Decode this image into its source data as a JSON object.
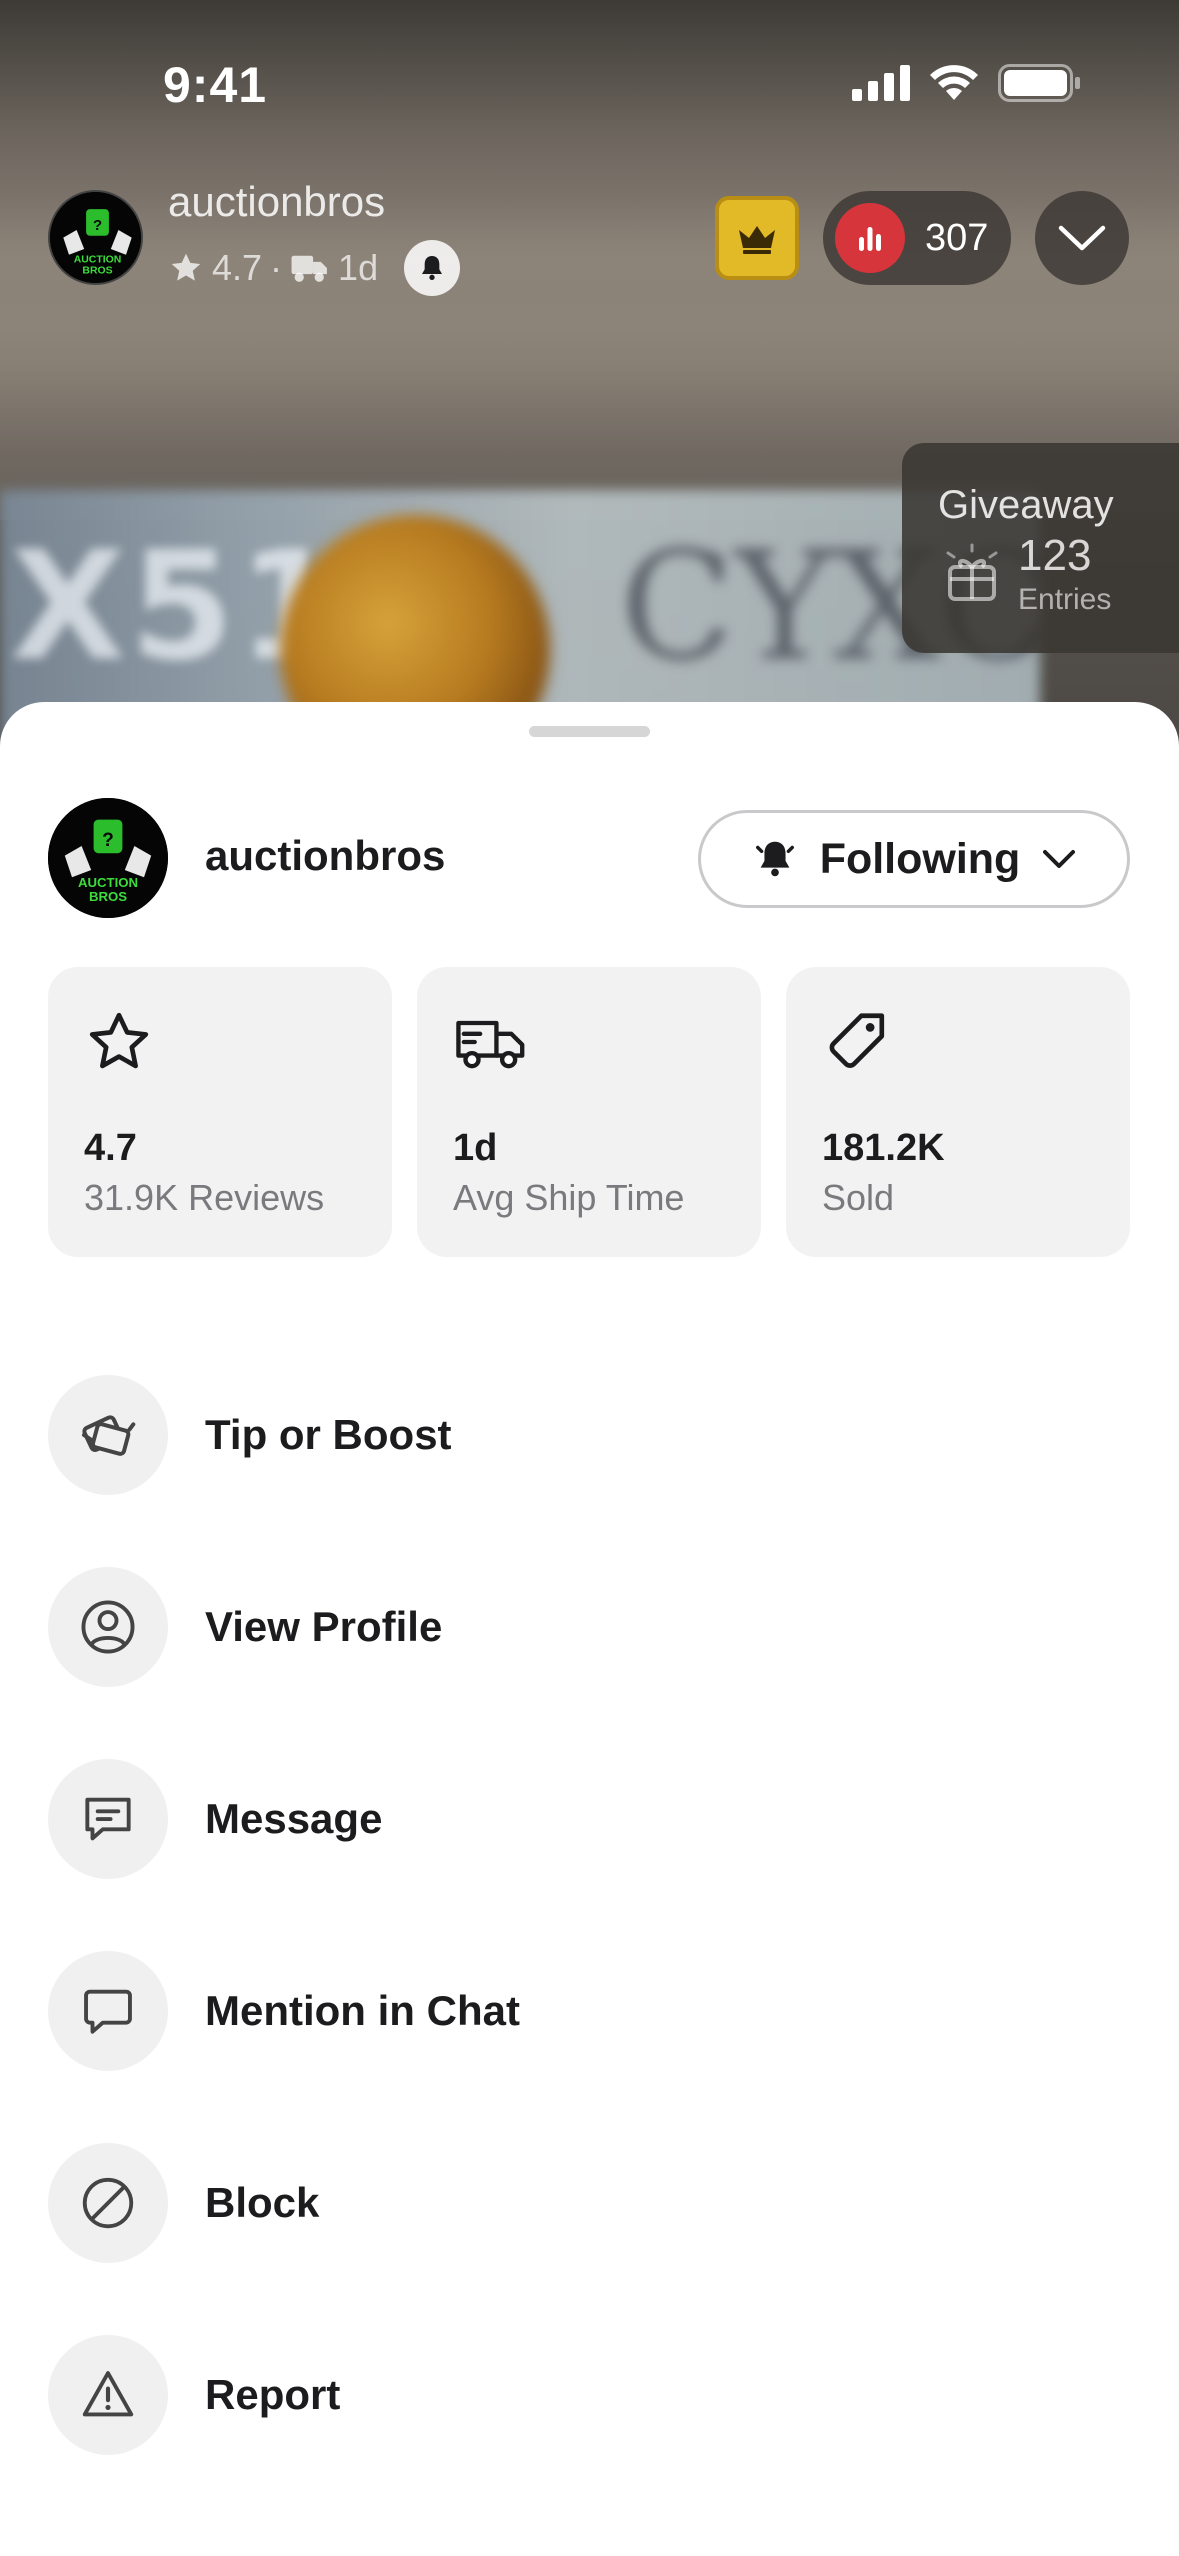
{
  "status_bar": {
    "time": "9:41"
  },
  "stream_header": {
    "seller_name": "auctionbros",
    "rating": "4.7",
    "separator": "·",
    "ship_time": "1d",
    "viewer_count": "307"
  },
  "giveaway": {
    "title": "Giveaway",
    "entries_count": "123",
    "entries_label": "Entries"
  },
  "avatar_logo": {
    "line1": "AUCTION",
    "line2": "BROS"
  },
  "sheet": {
    "seller_name": "auctionbros",
    "follow_label": "Following",
    "stats": [
      {
        "icon": "star-icon",
        "value": "4.7",
        "label": "31.9K Reviews"
      },
      {
        "icon": "truck-icon",
        "value": "1d",
        "label": "Avg Ship Time"
      },
      {
        "icon": "tag-icon",
        "value": "181.2K",
        "label": "Sold"
      }
    ],
    "menu": [
      {
        "icon": "boost-icon",
        "label": "Tip or Boost"
      },
      {
        "icon": "profile-icon",
        "label": "View Profile"
      },
      {
        "icon": "message-icon",
        "label": "Message"
      },
      {
        "icon": "chat-bubble-icon",
        "label": "Mention in Chat"
      },
      {
        "icon": "block-icon",
        "label": "Block"
      },
      {
        "icon": "warning-icon",
        "label": "Report"
      }
    ]
  },
  "colors": {
    "accent_live": "#d6353b",
    "crown_gold": "#e2b926",
    "logo_green": "#3ddc3d",
    "sheet_bg": "#ffffff",
    "card_bg": "#f2f2f2",
    "muted_text": "#7a7a7e"
  }
}
